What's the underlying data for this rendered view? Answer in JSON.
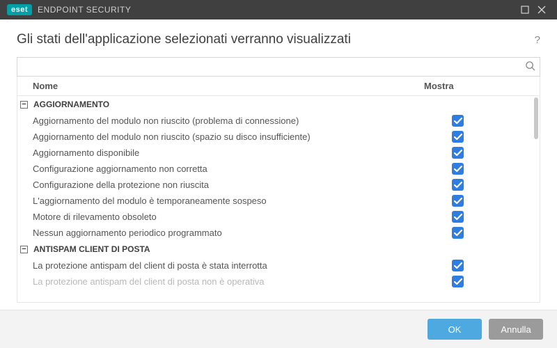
{
  "titlebar": {
    "brand": "eset",
    "product": "ENDPOINT SECURITY"
  },
  "header": {
    "title": "Gli stati dell'applicazione selezionati verranno visualizzati"
  },
  "search": {
    "placeholder": ""
  },
  "columns": {
    "name": "Nome",
    "show": "Mostra"
  },
  "groups": [
    {
      "label": "AGGIORNAMENTO",
      "expanded": true,
      "items": [
        {
          "label": "Aggiornamento del modulo non riuscito (problema di connessione)",
          "checked": true
        },
        {
          "label": "Aggiornamento del modulo non riuscito (spazio su disco insufficiente)",
          "checked": true
        },
        {
          "label": "Aggiornamento disponibile",
          "checked": true
        },
        {
          "label": "Configurazione aggiornamento non corretta",
          "checked": true
        },
        {
          "label": "Configurazione della protezione non riuscita",
          "checked": true
        },
        {
          "label": "L'aggiornamento del modulo è temporaneamente sospeso",
          "checked": true
        },
        {
          "label": "Motore di rilevamento obsoleto",
          "checked": true
        },
        {
          "label": "Nessun aggiornamento periodico programmato",
          "checked": true
        }
      ]
    },
    {
      "label": "ANTISPAM CLIENT DI POSTA",
      "expanded": true,
      "items": [
        {
          "label": "La protezione antispam del client di posta è stata interrotta",
          "checked": true
        },
        {
          "label": "La protezione antispam del client di posta non è operativa",
          "checked": true,
          "faded": true
        }
      ]
    }
  ],
  "footer": {
    "ok": "OK",
    "cancel": "Annulla"
  }
}
